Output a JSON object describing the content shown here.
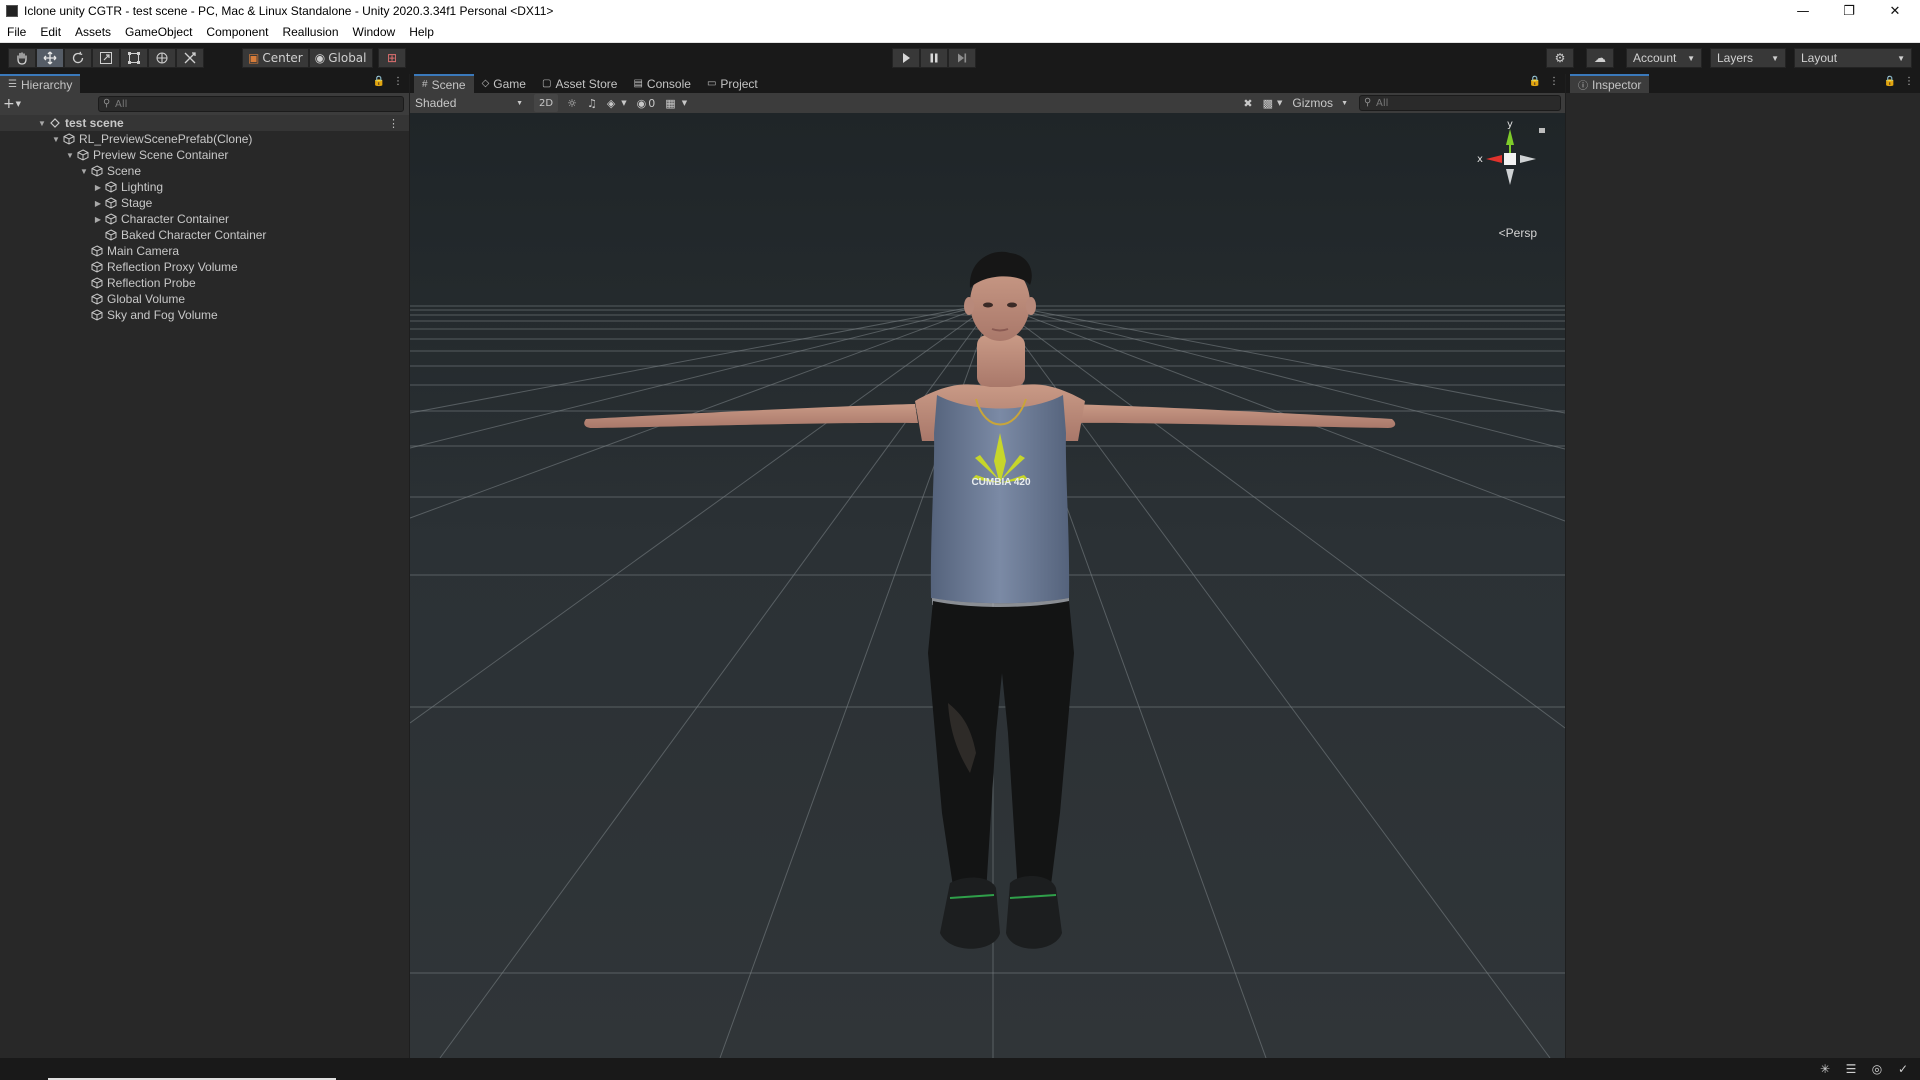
{
  "window": {
    "title": "Iclone unity CGTR - test scene - PC, Mac & Linux Standalone - Unity 2020.3.34f1 Personal <DX11>",
    "controls": {
      "minimize_icon": "minimize-icon",
      "restore_icon": "restore-icon",
      "close_icon": "close-icon"
    }
  },
  "menu": [
    "File",
    "Edit",
    "Assets",
    "GameObject",
    "Component",
    "Reallusion",
    "Window",
    "Help"
  ],
  "toolbar": {
    "tools": [
      "hand-tool-icon",
      "move-tool-icon",
      "rotate-tool-icon",
      "scale-tool-icon",
      "rect-tool-icon",
      "transform-tool-icon",
      "custom-tool-icon"
    ],
    "active_tool": "move-tool-icon",
    "pivot_mode": "Center",
    "pivot_rotation": "Global",
    "grid_snap_icon": "grid-snap-icon",
    "play_icon": "play-icon",
    "pause_icon": "pause-icon",
    "step_icon": "step-icon",
    "collab_icon": "collab-icon",
    "cloud_icon": "cloud-icon",
    "account": "Account",
    "layers": "Layers",
    "layout": "Layout"
  },
  "hierarchy": {
    "tab": "Hierarchy",
    "search_placeholder": "All",
    "create_label": "+",
    "items": [
      {
        "label": "test scene",
        "depth": 0,
        "fold": "open",
        "root": true
      },
      {
        "label": "RL_PreviewScenePrefab(Clone)",
        "depth": 1,
        "fold": "open"
      },
      {
        "label": "Preview Scene Container",
        "depth": 2,
        "fold": "open"
      },
      {
        "label": "Scene",
        "depth": 3,
        "fold": "open"
      },
      {
        "label": "Lighting",
        "depth": 4,
        "fold": "closed"
      },
      {
        "label": "Stage",
        "depth": 4,
        "fold": "closed"
      },
      {
        "label": "Character Container",
        "depth": 4,
        "fold": "closed"
      },
      {
        "label": "Baked Character Container",
        "depth": 4,
        "fold": "none"
      },
      {
        "label": "Main Camera",
        "depth": 3,
        "fold": "none"
      },
      {
        "label": "Reflection Proxy Volume",
        "depth": 3,
        "fold": "none"
      },
      {
        "label": "Reflection Probe",
        "depth": 3,
        "fold": "none"
      },
      {
        "label": "Global Volume",
        "depth": 3,
        "fold": "none"
      },
      {
        "label": "Sky and Fog Volume",
        "depth": 3,
        "fold": "none"
      }
    ]
  },
  "scene_tabs": [
    {
      "label": "Scene",
      "icon": "scene-grid-icon",
      "active": true
    },
    {
      "label": "Game",
      "icon": "game-controller-icon",
      "active": false
    },
    {
      "label": "Asset Store",
      "icon": "asset-store-icon",
      "active": false
    },
    {
      "label": "Console",
      "icon": "console-icon",
      "active": false
    },
    {
      "label": "Project",
      "icon": "folder-icon",
      "active": false
    }
  ],
  "scene_toolbar": {
    "draw_mode": "Shaded",
    "mode_2d": "2D",
    "hidden_count": "0",
    "gizmos": "Gizmos",
    "search_placeholder": "All"
  },
  "viewport": {
    "projection": "Persp",
    "axis_x": "x",
    "axis_y": "y",
    "shirt_text": "CUMBIA 420",
    "colors": {
      "axis_x": "#e0322c",
      "axis_y": "#7ecb2a",
      "axis_z": "#4a8fe0",
      "shirt": "#6f7f9a",
      "leaf": "#c7d62a"
    }
  },
  "inspector": {
    "tab": "Inspector",
    "icon": "info-icon"
  },
  "statusbar": {
    "progress": 1.0,
    "icons": [
      "bug-icon",
      "layers-status-icon",
      "network-icon",
      "check-circle-icon"
    ]
  }
}
